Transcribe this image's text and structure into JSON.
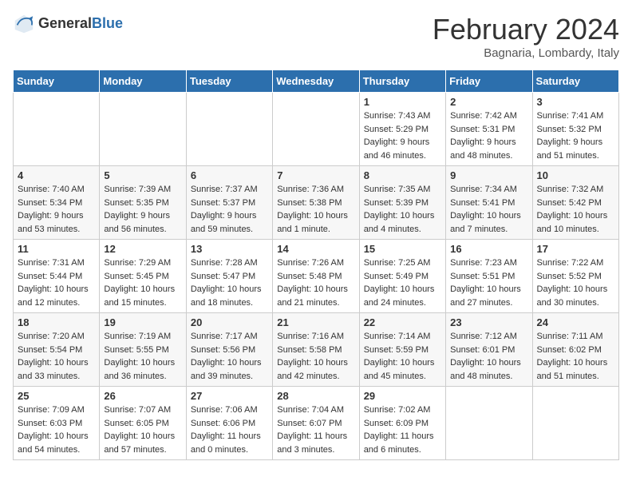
{
  "logo": {
    "general": "General",
    "blue": "Blue"
  },
  "title": "February 2024",
  "subtitle": "Bagnaria, Lombardy, Italy",
  "days_of_week": [
    "Sunday",
    "Monday",
    "Tuesday",
    "Wednesday",
    "Thursday",
    "Friday",
    "Saturday"
  ],
  "weeks": [
    [
      {
        "day": "",
        "info": ""
      },
      {
        "day": "",
        "info": ""
      },
      {
        "day": "",
        "info": ""
      },
      {
        "day": "",
        "info": ""
      },
      {
        "day": "1",
        "info": "Sunrise: 7:43 AM\nSunset: 5:29 PM\nDaylight: 9 hours\nand 46 minutes."
      },
      {
        "day": "2",
        "info": "Sunrise: 7:42 AM\nSunset: 5:31 PM\nDaylight: 9 hours\nand 48 minutes."
      },
      {
        "day": "3",
        "info": "Sunrise: 7:41 AM\nSunset: 5:32 PM\nDaylight: 9 hours\nand 51 minutes."
      }
    ],
    [
      {
        "day": "4",
        "info": "Sunrise: 7:40 AM\nSunset: 5:34 PM\nDaylight: 9 hours\nand 53 minutes."
      },
      {
        "day": "5",
        "info": "Sunrise: 7:39 AM\nSunset: 5:35 PM\nDaylight: 9 hours\nand 56 minutes."
      },
      {
        "day": "6",
        "info": "Sunrise: 7:37 AM\nSunset: 5:37 PM\nDaylight: 9 hours\nand 59 minutes."
      },
      {
        "day": "7",
        "info": "Sunrise: 7:36 AM\nSunset: 5:38 PM\nDaylight: 10 hours\nand 1 minute."
      },
      {
        "day": "8",
        "info": "Sunrise: 7:35 AM\nSunset: 5:39 PM\nDaylight: 10 hours\nand 4 minutes."
      },
      {
        "day": "9",
        "info": "Sunrise: 7:34 AM\nSunset: 5:41 PM\nDaylight: 10 hours\nand 7 minutes."
      },
      {
        "day": "10",
        "info": "Sunrise: 7:32 AM\nSunset: 5:42 PM\nDaylight: 10 hours\nand 10 minutes."
      }
    ],
    [
      {
        "day": "11",
        "info": "Sunrise: 7:31 AM\nSunset: 5:44 PM\nDaylight: 10 hours\nand 12 minutes."
      },
      {
        "day": "12",
        "info": "Sunrise: 7:29 AM\nSunset: 5:45 PM\nDaylight: 10 hours\nand 15 minutes."
      },
      {
        "day": "13",
        "info": "Sunrise: 7:28 AM\nSunset: 5:47 PM\nDaylight: 10 hours\nand 18 minutes."
      },
      {
        "day": "14",
        "info": "Sunrise: 7:26 AM\nSunset: 5:48 PM\nDaylight: 10 hours\nand 21 minutes."
      },
      {
        "day": "15",
        "info": "Sunrise: 7:25 AM\nSunset: 5:49 PM\nDaylight: 10 hours\nand 24 minutes."
      },
      {
        "day": "16",
        "info": "Sunrise: 7:23 AM\nSunset: 5:51 PM\nDaylight: 10 hours\nand 27 minutes."
      },
      {
        "day": "17",
        "info": "Sunrise: 7:22 AM\nSunset: 5:52 PM\nDaylight: 10 hours\nand 30 minutes."
      }
    ],
    [
      {
        "day": "18",
        "info": "Sunrise: 7:20 AM\nSunset: 5:54 PM\nDaylight: 10 hours\nand 33 minutes."
      },
      {
        "day": "19",
        "info": "Sunrise: 7:19 AM\nSunset: 5:55 PM\nDaylight: 10 hours\nand 36 minutes."
      },
      {
        "day": "20",
        "info": "Sunrise: 7:17 AM\nSunset: 5:56 PM\nDaylight: 10 hours\nand 39 minutes."
      },
      {
        "day": "21",
        "info": "Sunrise: 7:16 AM\nSunset: 5:58 PM\nDaylight: 10 hours\nand 42 minutes."
      },
      {
        "day": "22",
        "info": "Sunrise: 7:14 AM\nSunset: 5:59 PM\nDaylight: 10 hours\nand 45 minutes."
      },
      {
        "day": "23",
        "info": "Sunrise: 7:12 AM\nSunset: 6:01 PM\nDaylight: 10 hours\nand 48 minutes."
      },
      {
        "day": "24",
        "info": "Sunrise: 7:11 AM\nSunset: 6:02 PM\nDaylight: 10 hours\nand 51 minutes."
      }
    ],
    [
      {
        "day": "25",
        "info": "Sunrise: 7:09 AM\nSunset: 6:03 PM\nDaylight: 10 hours\nand 54 minutes."
      },
      {
        "day": "26",
        "info": "Sunrise: 7:07 AM\nSunset: 6:05 PM\nDaylight: 10 hours\nand 57 minutes."
      },
      {
        "day": "27",
        "info": "Sunrise: 7:06 AM\nSunset: 6:06 PM\nDaylight: 11 hours\nand 0 minutes."
      },
      {
        "day": "28",
        "info": "Sunrise: 7:04 AM\nSunset: 6:07 PM\nDaylight: 11 hours\nand 3 minutes."
      },
      {
        "day": "29",
        "info": "Sunrise: 7:02 AM\nSunset: 6:09 PM\nDaylight: 11 hours\nand 6 minutes."
      },
      {
        "day": "",
        "info": ""
      },
      {
        "day": "",
        "info": ""
      }
    ]
  ]
}
